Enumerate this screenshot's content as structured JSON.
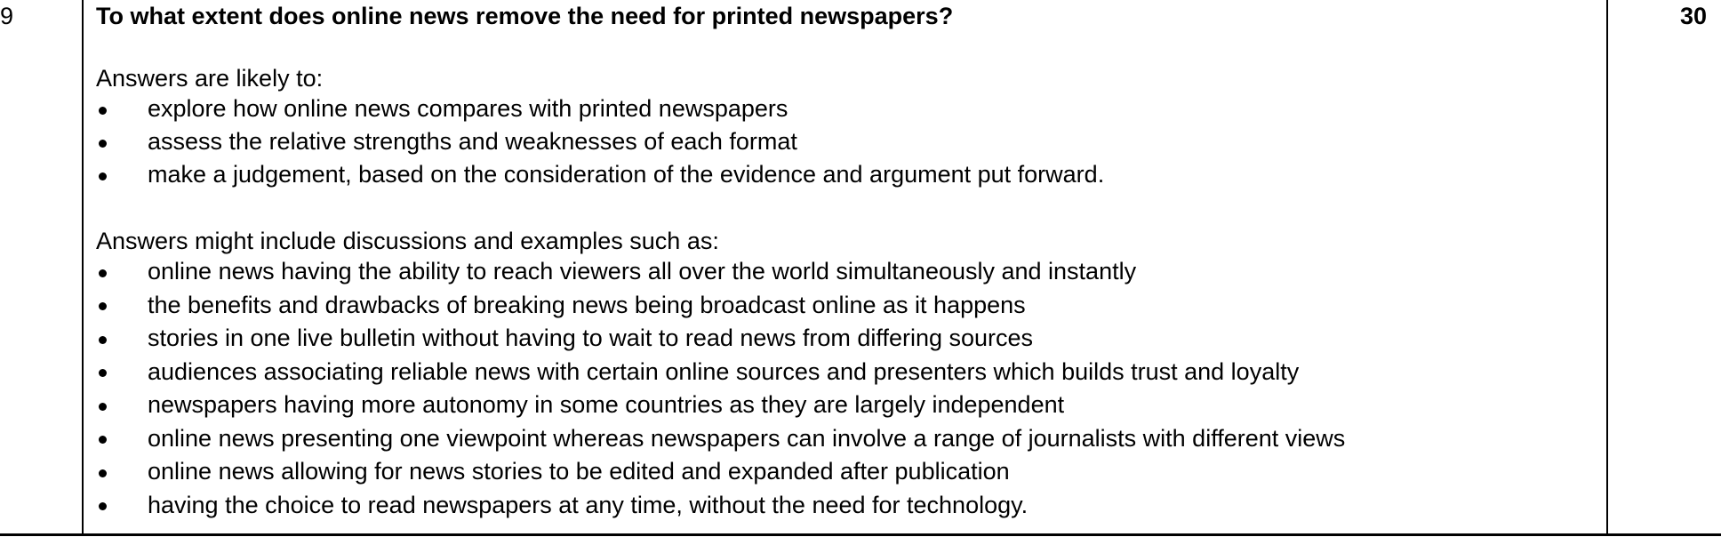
{
  "question": {
    "number": "9",
    "title": "To what extent does online news remove the need for printed newspapers?",
    "marks": "30"
  },
  "sections": [
    {
      "intro": "Answers are likely to:",
      "bullets": [
        "explore how online news compares with printed newspapers",
        "assess the relative strengths and weaknesses of each format",
        "make a judgement, based on the consideration of the evidence and argument put forward."
      ]
    },
    {
      "intro": "Answers might include discussions and examples such as:",
      "bullets": [
        "online news having the ability to reach viewers all over the world simultaneously and instantly",
        "the benefits and drawbacks of breaking news being broadcast online as it happens",
        "stories in one live bulletin without having to wait to read news from differing sources",
        "audiences associating reliable news with certain online sources and presenters which builds trust and loyalty",
        "newspapers having more autonomy in some countries as they are largely independent",
        "online news presenting one viewpoint whereas newspapers can involve a range of journalists with different views",
        "online news allowing for news stories to be edited and expanded after publication",
        "having the choice to read newspapers at any time, without the need for technology."
      ]
    }
  ]
}
